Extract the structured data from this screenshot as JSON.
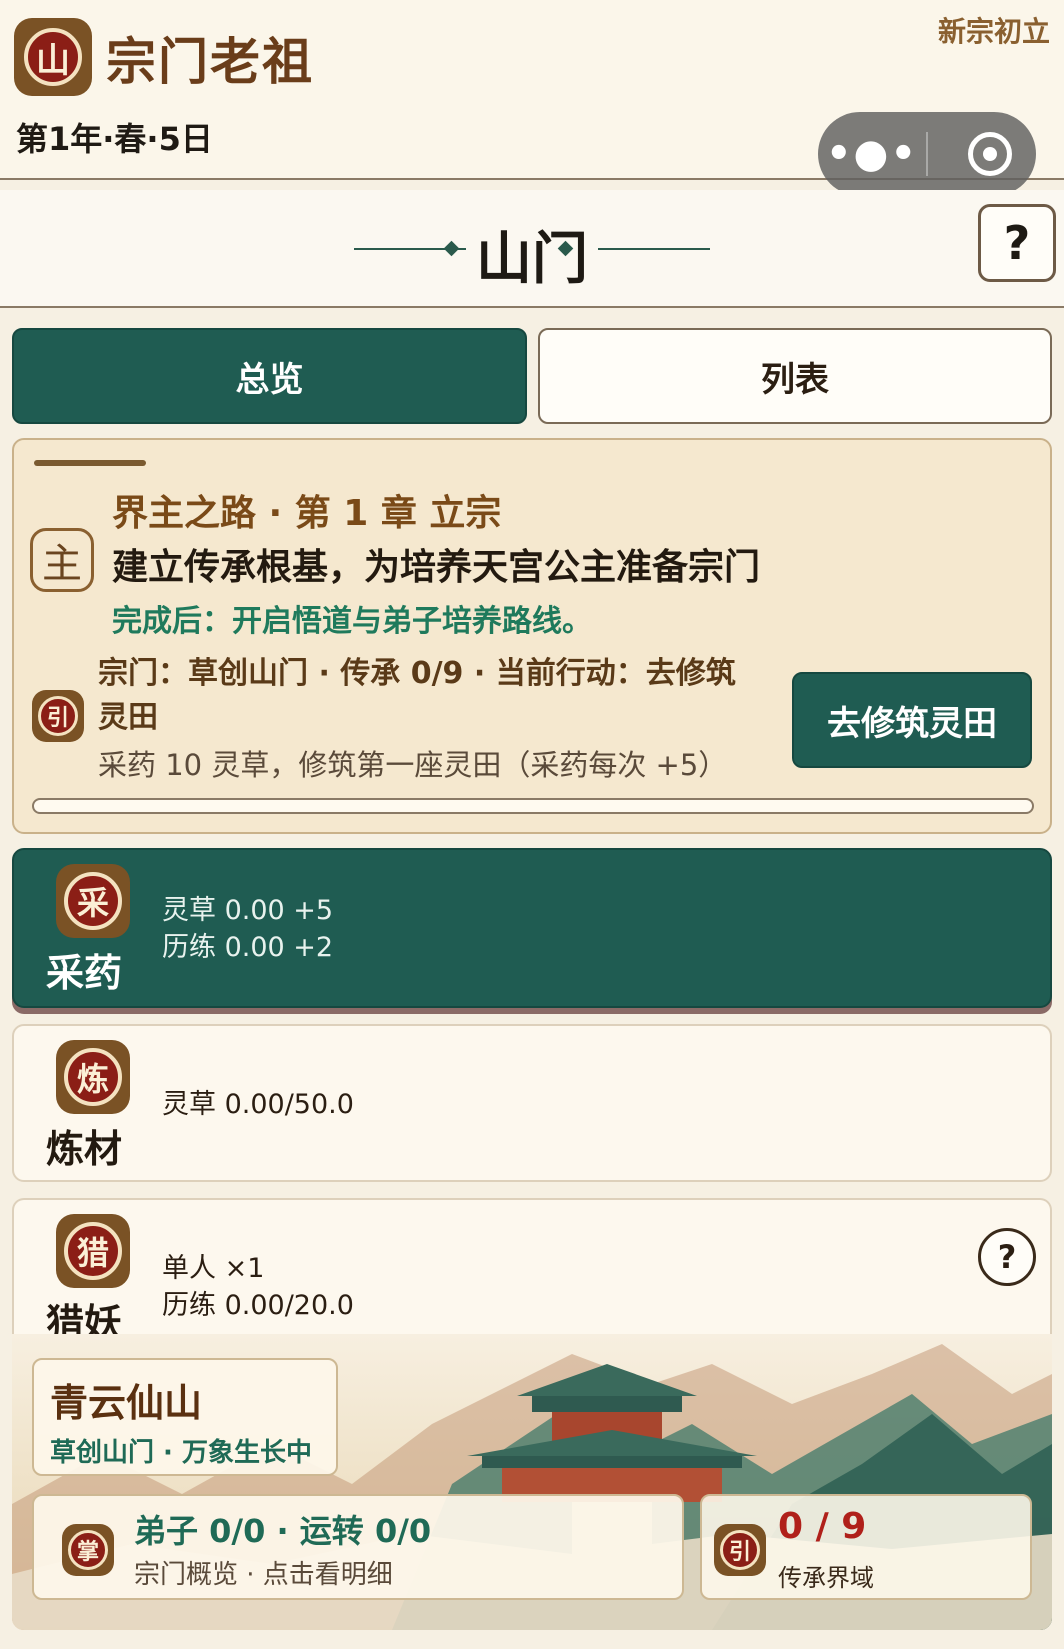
{
  "header": {
    "logo_char": "山",
    "title": "宗门老祖",
    "date": "第1年·春·5日",
    "tag": "新宗初立",
    "capsule_more": "•●•"
  },
  "section": {
    "title": "山门",
    "help": "?"
  },
  "tabs": [
    {
      "label": "总览",
      "active": true
    },
    {
      "label": "列表",
      "active": false
    }
  ],
  "quest": {
    "badge": "主",
    "chapter": "界主之路 · 第 1 章 立宗",
    "goal": "建立传承根基，为培养天宫公主准备宗门",
    "reward": "完成后：开启悟道与弟子培养路线。",
    "guide_badge": "引",
    "status": "宗门：草创山门 · 传承 0/9 · 当前行动：去修筑灵田",
    "hint": "采药 10 灵草，修筑第一座灵田（采药每次 +5）",
    "action_label": "去修筑灵田",
    "progress": 0
  },
  "actions": [
    {
      "icon": "采",
      "name": "采药",
      "lines": [
        "灵草 0.00 +5",
        "历练 0.00 +2"
      ],
      "active": true
    },
    {
      "icon": "炼",
      "name": "炼材",
      "lines": [
        "灵草 0.00/50.0"
      ],
      "active": false
    },
    {
      "icon": "猎",
      "name": "猎妖",
      "lines": [
        "单人 ×1",
        "历练 0.00/20.0"
      ],
      "active": false,
      "help": "?"
    }
  ],
  "scene": {
    "place_name": "青云仙山",
    "place_sub": "草创山门 · 万象生长中",
    "stat_icon": "掌",
    "stat_main": "弟子 0/0 · 运转 0/0",
    "stat_sub": "宗门概览 · 点击看明细",
    "legacy_icon": "引",
    "legacy_count": "0 / 9",
    "legacy_label": "传承界域"
  },
  "colors": {
    "primary": "#1f5c52",
    "seal_red": "#8b1e16",
    "bronze": "#7a5225",
    "paper": "#f6f0e3",
    "reward_green": "#1f7a5c"
  },
  "icons": [
    "mountain-seal-icon",
    "more-dots-icon",
    "close-circle-icon",
    "help-icon",
    "main-quest-icon",
    "guide-seal-icon",
    "gather-herb-icon",
    "refine-icon",
    "hunt-icon",
    "sect-master-icon"
  ]
}
